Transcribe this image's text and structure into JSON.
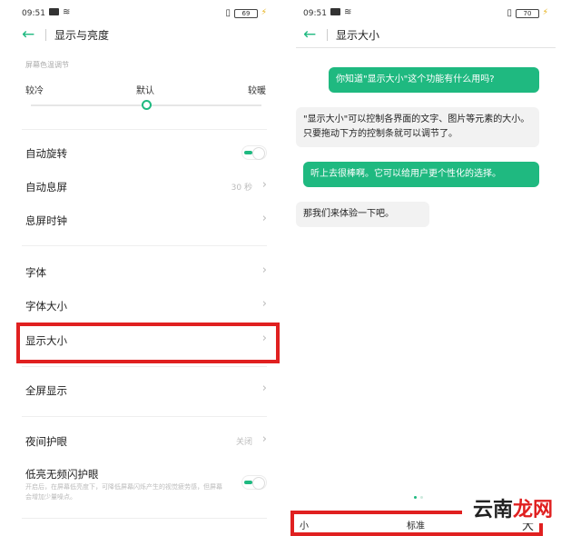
{
  "left": {
    "status": {
      "time": "09:51",
      "battery": "69"
    },
    "header": {
      "title": "显示与亮度"
    },
    "color_temp": {
      "label": "屏幕色温调节",
      "cold": "较冷",
      "default": "默认",
      "warm": "较暖",
      "level": 0.5
    },
    "rows": {
      "auto_rotate": "自动旋转",
      "auto_lock": "自动息屏",
      "auto_lock_value": "30 秒",
      "lock_clock": "息屏时钟",
      "font": "字体",
      "font_size": "字体大小",
      "display_size": "显示大小",
      "fullscreen": "全屏显示",
      "night_mode": "夜间护眼",
      "night_mode_value": "关闭",
      "low_flicker": "低亮无频闪护眼",
      "low_flicker_desc": "开启后，在屏幕低亮度下，可降低屏幕闪烁产生的视觉疲劳感，但屏幕会增加少量噪点。"
    }
  },
  "right": {
    "status": {
      "time": "09:51",
      "battery": "70"
    },
    "header": {
      "title": "显示大小"
    },
    "messages": [
      "你知道\"显示大小\"这个功能有什么用吗?",
      "\"显示大小\"可以控制各界面的文字、图片等元素的大小。只要拖动下方的控制条就可以调节了。",
      "听上去很棒啊。它可以给用户更个性化的选择。",
      "那我们来体验一下吧。"
    ],
    "slider": {
      "small": "小",
      "standard": "标准",
      "large": "大"
    }
  },
  "watermark": {
    "part1": "云南",
    "part2": "龙网"
  },
  "colors": {
    "accent": "#1fb980",
    "highlight": "#e02020"
  }
}
